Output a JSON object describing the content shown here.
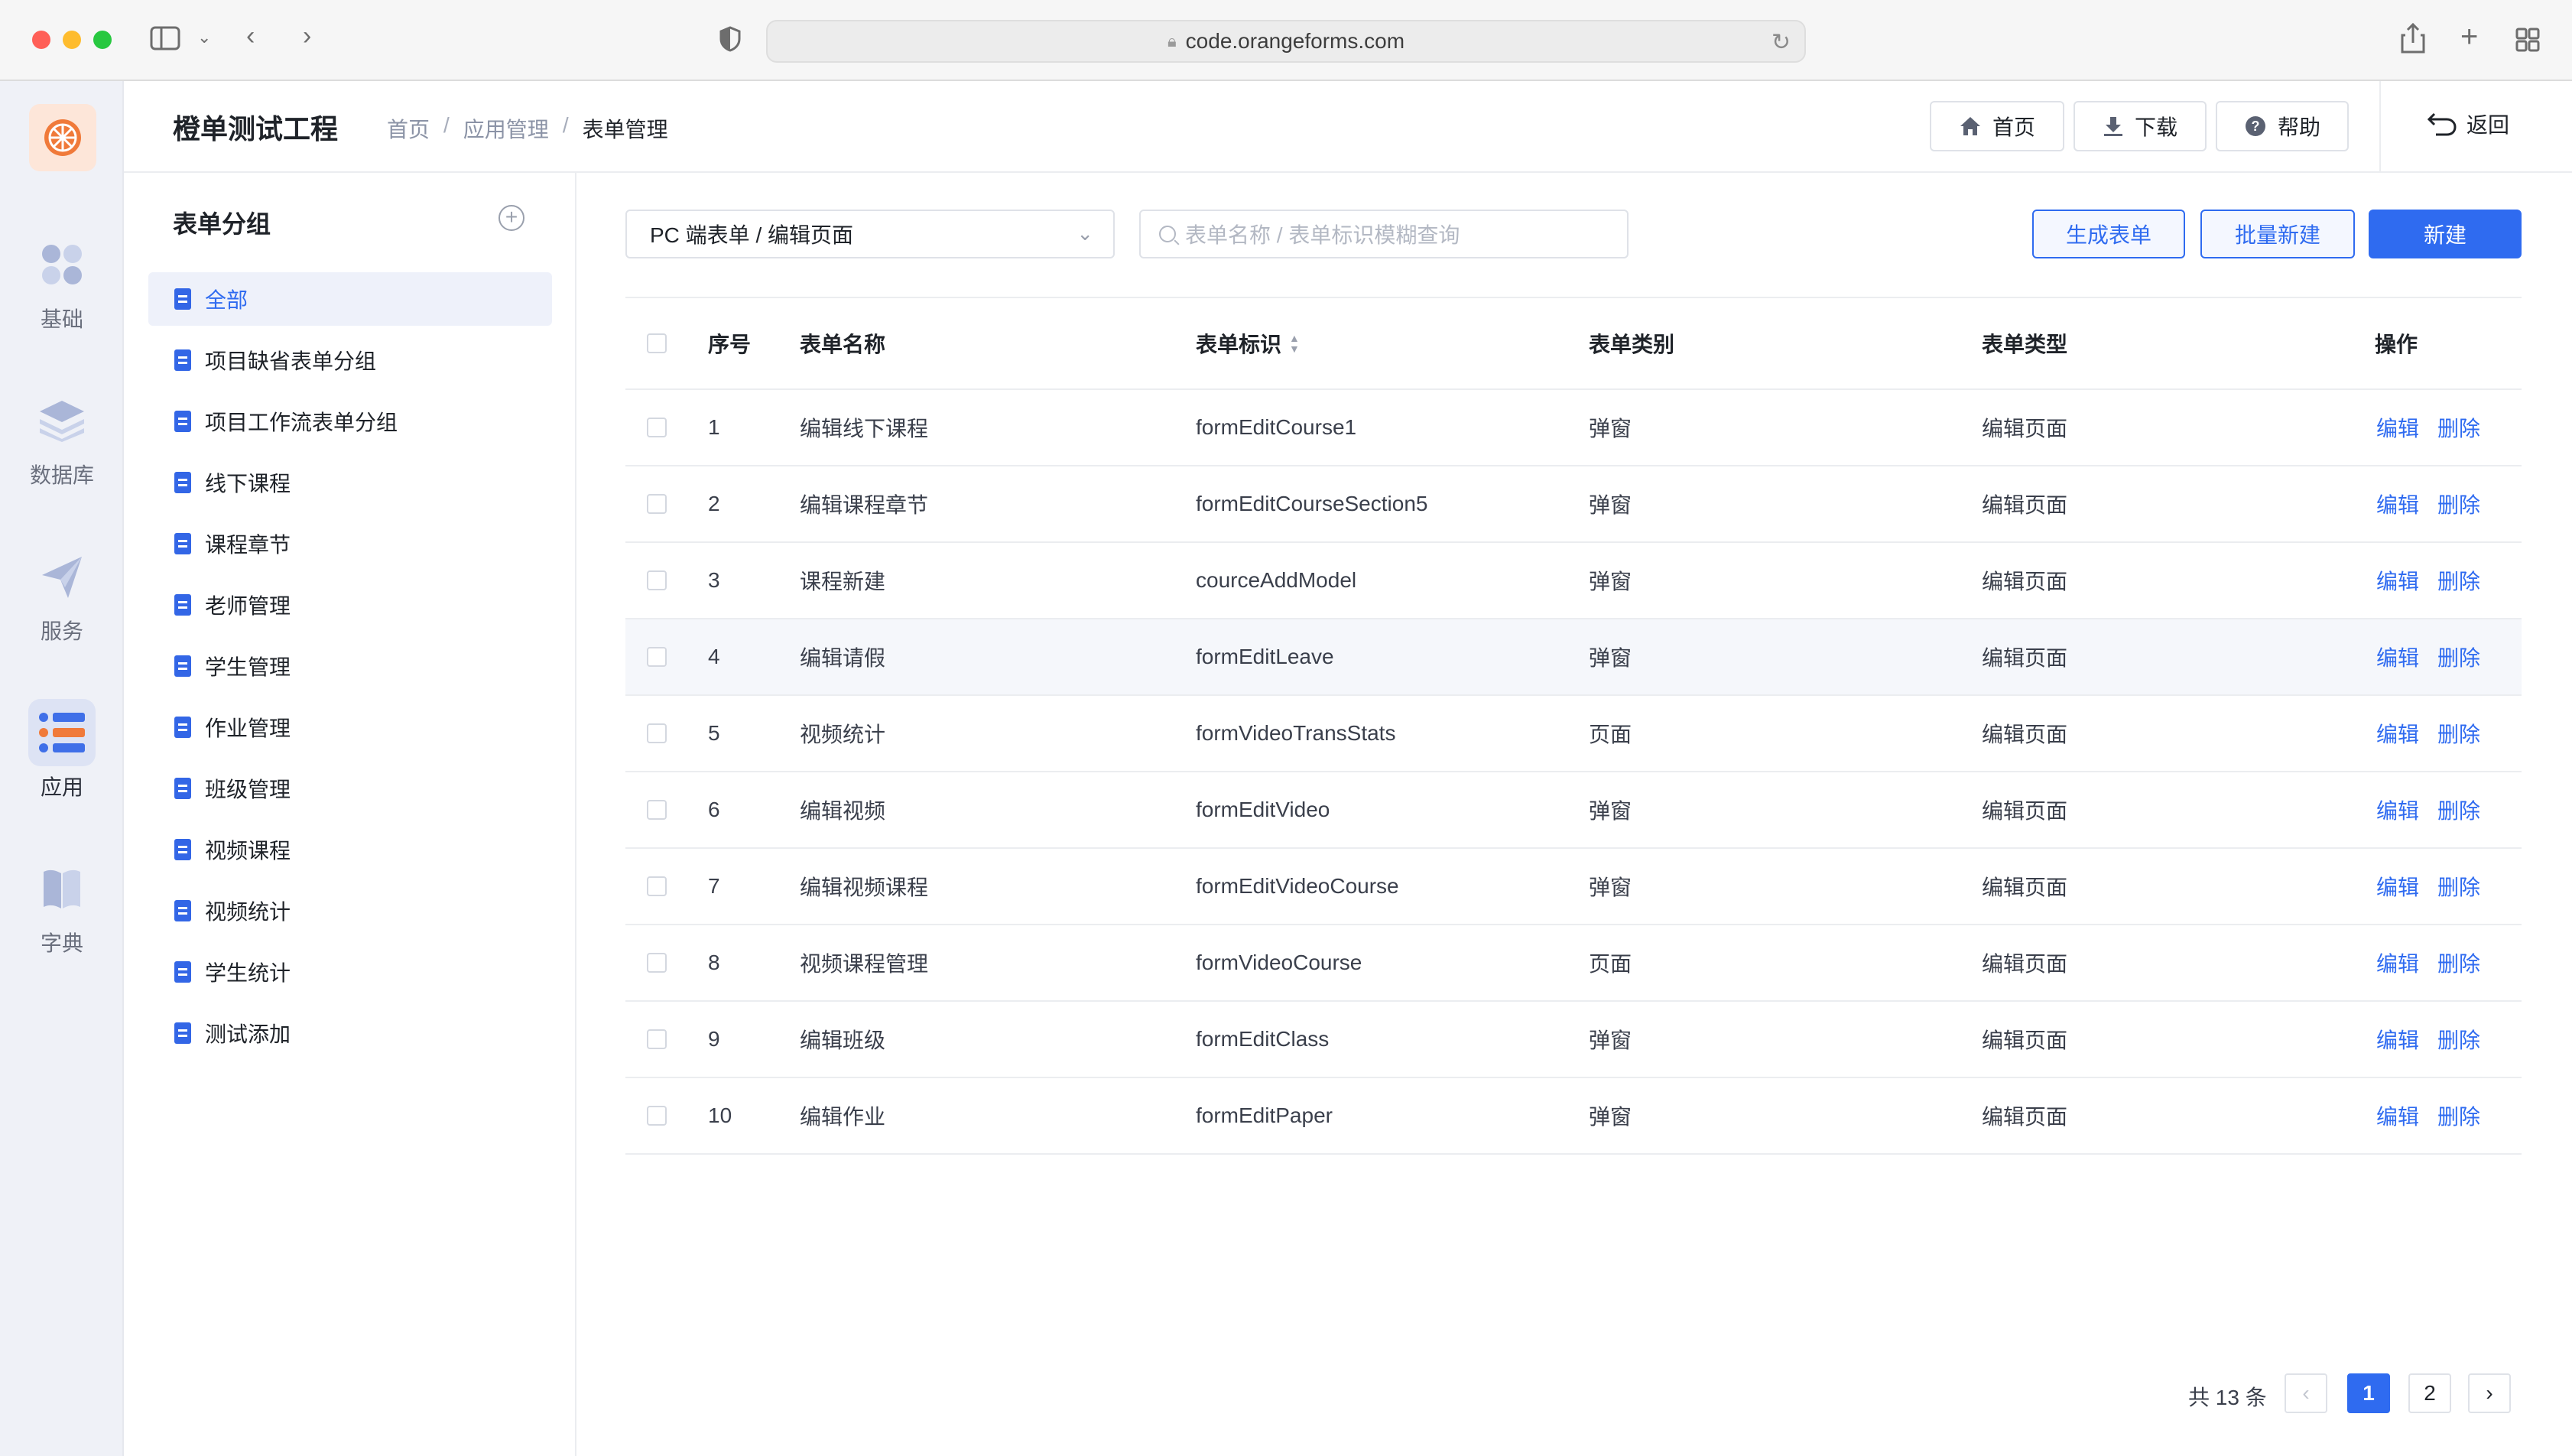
{
  "browser": {
    "url": "code.orangeforms.com"
  },
  "rail": {
    "items": [
      {
        "label": "基础"
      },
      {
        "label": "数据库"
      },
      {
        "label": "服务"
      },
      {
        "label": "应用"
      },
      {
        "label": "字典"
      }
    ],
    "active": "应用"
  },
  "header": {
    "title": "橙单测试工程",
    "breadcrumb": [
      "首页",
      "应用管理",
      "表单管理"
    ],
    "buttons": {
      "home": "首页",
      "download": "下载",
      "help": "帮助",
      "back": "返回"
    }
  },
  "groups": {
    "title": "表单分组",
    "items": [
      {
        "label": "全部"
      },
      {
        "label": "项目缺省表单分组"
      },
      {
        "label": "项目工作流表单分组"
      },
      {
        "label": "线下课程"
      },
      {
        "label": "课程章节"
      },
      {
        "label": "老师管理"
      },
      {
        "label": "学生管理"
      },
      {
        "label": "作业管理"
      },
      {
        "label": "班级管理"
      },
      {
        "label": "视频课程"
      },
      {
        "label": "视频统计"
      },
      {
        "label": "学生统计"
      },
      {
        "label": "测试添加"
      }
    ]
  },
  "toolbar": {
    "select_value": "PC 端表单 / 编辑页面",
    "search_placeholder": "表单名称 / 表单标识模糊查询",
    "generate_label": "生成表单",
    "batch_label": "批量新建",
    "new_label": "新建"
  },
  "table": {
    "columns": [
      "序号",
      "表单名称",
      "表单标识",
      "表单类别",
      "表单类型",
      "操作"
    ],
    "rows": [
      {
        "no": "1",
        "name": "编辑线下课程",
        "key": "formEditCourse1",
        "category": "弹窗",
        "type": "编辑页面"
      },
      {
        "no": "2",
        "name": "编辑课程章节",
        "key": "formEditCourseSection5",
        "category": "弹窗",
        "type": "编辑页面"
      },
      {
        "no": "3",
        "name": "课程新建",
        "key": "courceAddModel",
        "category": "弹窗",
        "type": "编辑页面"
      },
      {
        "no": "4",
        "name": "编辑请假",
        "key": "formEditLeave",
        "category": "弹窗",
        "type": "编辑页面"
      },
      {
        "no": "5",
        "name": "视频统计",
        "key": "formVideoTransStats",
        "category": "页面",
        "type": "编辑页面"
      },
      {
        "no": "6",
        "name": "编辑视频",
        "key": "formEditVideo",
        "category": "弹窗",
        "type": "编辑页面"
      },
      {
        "no": "7",
        "name": "编辑视频课程",
        "key": "formEditVideoCourse",
        "category": "弹窗",
        "type": "编辑页面"
      },
      {
        "no": "8",
        "name": "视频课程管理",
        "key": "formVideoCourse",
        "category": "页面",
        "type": "编辑页面"
      },
      {
        "no": "9",
        "name": "编辑班级",
        "key": "formEditClass",
        "category": "弹窗",
        "type": "编辑页面"
      },
      {
        "no": "10",
        "name": "编辑作业",
        "key": "formEditPaper",
        "category": "弹窗",
        "type": "编辑页面"
      }
    ],
    "actions": {
      "edit": "编辑",
      "delete": "删除"
    }
  },
  "pagination": {
    "total_text": "共 13 条",
    "pages": [
      "1",
      "2"
    ],
    "current": "1"
  },
  "colors": {
    "accent": "#2f6bf0",
    "brand": "#f07a3a"
  }
}
